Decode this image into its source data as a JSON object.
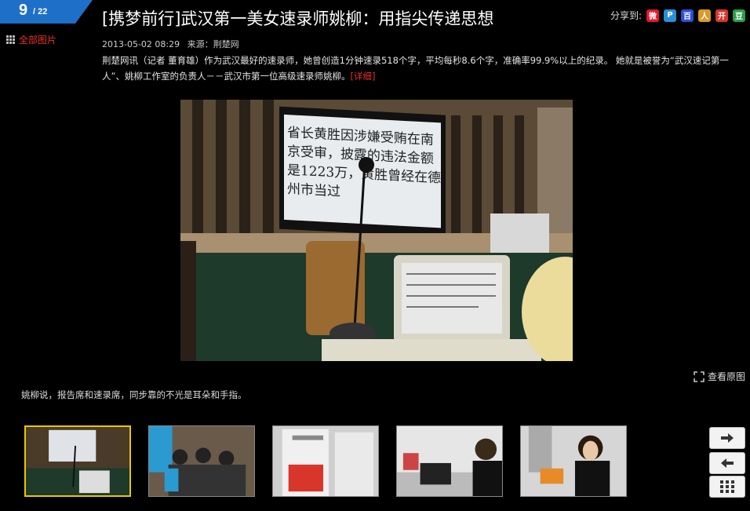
{
  "gallery": {
    "current": "9",
    "total": "/ 22",
    "all_pictures_label": "全部图片"
  },
  "article": {
    "title": "[携梦前行]武汉第一美女速录师姚柳：用指尖传递思想",
    "date": "2013-05-02 08:29",
    "source": "来源：荆楚网",
    "description": "荆楚网讯（记者 董育雄）作为武汉最好的速录师，她曾创造1分钟速录518个字，平均每秒8.6个字，准确率99.9%以上的纪录。  她就是被誉为“武汉速记第一人”、姚柳工作室的负责人－－武汉市第一位高级速录师姚柳。",
    "more_link": "[详细]"
  },
  "share": {
    "label": "分享到:",
    "targets": [
      {
        "name": "weibo-share-icon",
        "glyph": "微",
        "color": "#e6162d"
      },
      {
        "name": "qzone-share-icon",
        "glyph": "P",
        "color": "#2a8fd8"
      },
      {
        "name": "baidu-share-icon",
        "glyph": "百",
        "color": "#2a4fd8"
      },
      {
        "name": "renren-share-icon",
        "glyph": "人",
        "color": "#d89a2a"
      },
      {
        "name": "kaixin-share-icon",
        "glyph": "开",
        "color": "#d8362a"
      },
      {
        "name": "douban-share-icon",
        "glyph": "豆",
        "color": "#2a9d4a"
      }
    ]
  },
  "photo": {
    "screen_text": [
      "省长黄胜因涉嫌受贿在南",
      "京受审，披露的违法金额",
      "是1223万，黄胜曾经在德",
      "州市当过"
    ]
  },
  "view_original": "查看原图",
  "caption": "姚柳说，报告席和速录席，同步靠的不光是耳朵和手指。",
  "thumbnails": [
    {
      "name": "thumbnail-1",
      "active": true
    },
    {
      "name": "thumbnail-2",
      "active": false
    },
    {
      "name": "thumbnail-3",
      "active": false
    },
    {
      "name": "thumbnail-4",
      "active": false
    },
    {
      "name": "thumbnail-5",
      "active": false
    }
  ],
  "colors": {
    "accent": "#e8322d",
    "counter_blue": "#1e6fc8",
    "active_thumb": "#e8c800"
  }
}
